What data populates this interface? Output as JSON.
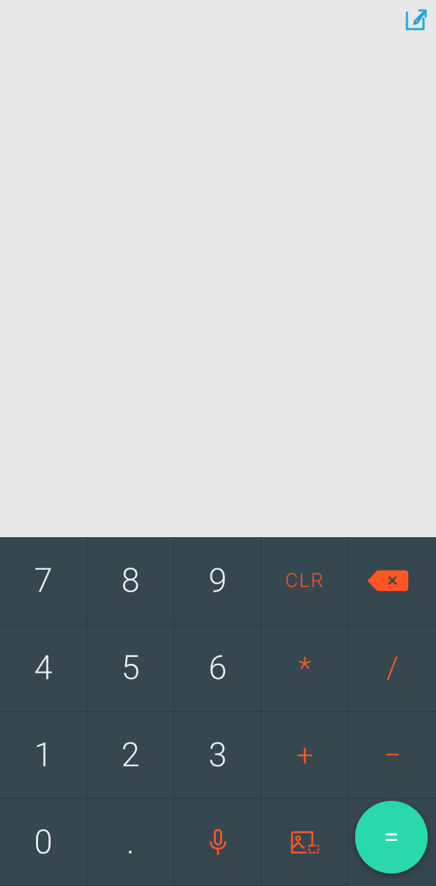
{
  "colors": {
    "accent": "#ff5722",
    "fab": "#29d9a9",
    "icon_blue": "#1ea4e0",
    "keypad_bg": "#37474f",
    "key_text": "#eceff1"
  },
  "display": {
    "value": ""
  },
  "icons": {
    "edit": "edit-icon",
    "backspace": "backspace-icon",
    "mic": "mic-icon",
    "image": "image-icon"
  },
  "keys": {
    "row1": {
      "k1": "7",
      "k2": "8",
      "k3": "9",
      "k4": "CLR",
      "k5_name": "backspace"
    },
    "row2": {
      "k1": "4",
      "k2": "5",
      "k3": "6",
      "k4": "*",
      "k5": "/"
    },
    "row3": {
      "k1": "1",
      "k2": "2",
      "k3": "3",
      "k4": "+",
      "k5": "−"
    },
    "row4": {
      "k1": "0",
      "k2": ".",
      "k3_name": "mic",
      "k4_name": "image",
      "k5_fab": "="
    }
  }
}
